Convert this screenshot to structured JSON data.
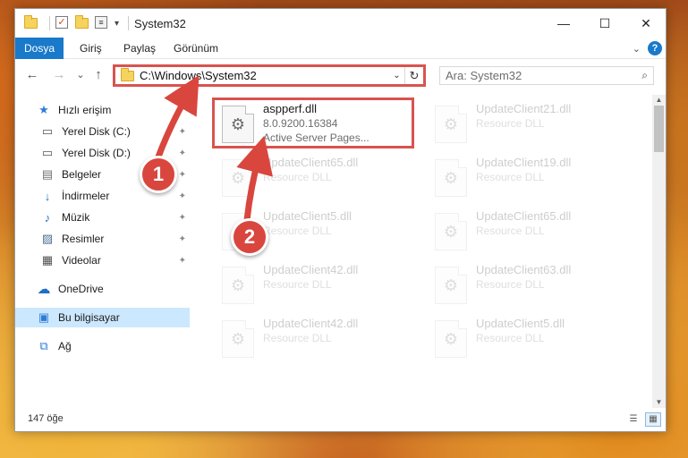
{
  "window": {
    "title": "System32",
    "quick_access_dropdown": "▾",
    "minimize": "—",
    "maximize": "☐",
    "close": "✕"
  },
  "ribbon": {
    "tabs": [
      "Dosya",
      "Giriş",
      "Paylaş",
      "Görünüm"
    ],
    "expand_label": "⌄",
    "help_label": "?"
  },
  "nav": {
    "back": "←",
    "forward": "→",
    "recent": "⌄",
    "up": "↑",
    "address": "C:\\Windows\\System32",
    "address_dropdown": "⌄",
    "refresh": "↻",
    "search_placeholder": "Ara: System32",
    "search_icon": "⌕"
  },
  "sidebar": {
    "items": [
      {
        "label": "Hızlı erişim",
        "icon": "star-icon",
        "glyph": "★",
        "color": "#2e7cd6",
        "pinned": false
      },
      {
        "label": "Yerel Disk (C:)",
        "icon": "drive-icon",
        "glyph": "▭",
        "color": "#555555",
        "pinned": true
      },
      {
        "label": "Yerel Disk (D:)",
        "icon": "drive-icon",
        "glyph": "▭",
        "color": "#555555",
        "pinned": true
      },
      {
        "label": "Belgeler",
        "icon": "documents-icon",
        "glyph": "▤",
        "color": "#6f6f6f",
        "pinned": true
      },
      {
        "label": "İndirmeler",
        "icon": "downloads-icon",
        "glyph": "↓",
        "color": "#1f6fc5",
        "pinned": true
      },
      {
        "label": "Müzik",
        "icon": "music-icon",
        "glyph": "♪",
        "color": "#1f6fc5",
        "pinned": true
      },
      {
        "label": "Resimler",
        "icon": "pictures-icon",
        "glyph": "▨",
        "color": "#4f6f8f",
        "pinned": true
      },
      {
        "label": "Videolar",
        "icon": "videos-icon",
        "glyph": "▦",
        "color": "#4f4f4f",
        "pinned": true
      },
      {
        "label": "OneDrive",
        "icon": "onedrive-icon",
        "glyph": "☁",
        "color": "#1f6fc5",
        "pinned": false
      },
      {
        "label": "Bu bilgisayar",
        "icon": "computer-icon",
        "glyph": "▣",
        "color": "#2e7cd6",
        "pinned": false
      },
      {
        "label": "Ağ",
        "icon": "network-icon",
        "glyph": "⧉",
        "color": "#2e7cd6",
        "pinned": false
      }
    ],
    "pin_glyph": "✦"
  },
  "files": [
    {
      "name": "aspperf.dll",
      "line2": "8.0.9200.16384",
      "line3": "Active Server Pages...",
      "faded": false
    },
    {
      "name": "UpdateClient21.dll",
      "line2": "Resource DLL",
      "faded": true
    },
    {
      "name": "UpdateClient65.dll",
      "line2": "Resource DLL",
      "faded": true
    },
    {
      "name": "UpdateClient19.dll",
      "line2": "Resource DLL",
      "faded": true
    },
    {
      "name": "UpdateClient5.dll",
      "line2": "Resource DLL",
      "faded": true
    },
    {
      "name": "UpdateClient65.dll",
      "line2": "Resource DLL",
      "faded": true
    },
    {
      "name": "UpdateClient42.dll",
      "line2": "Resource DLL",
      "faded": true
    },
    {
      "name": "UpdateClient63.dll",
      "line2": "Resource DLL",
      "faded": true
    },
    {
      "name": "UpdateClient42.dll",
      "line2": "Resource DLL",
      "faded": true
    },
    {
      "name": "UpdateClient5.dll",
      "line2": "Resource DLL",
      "faded": true
    }
  ],
  "status": {
    "count": "147 öğe"
  },
  "annotations": {
    "step1": "1",
    "step2": "2",
    "color": "#d9463e"
  }
}
